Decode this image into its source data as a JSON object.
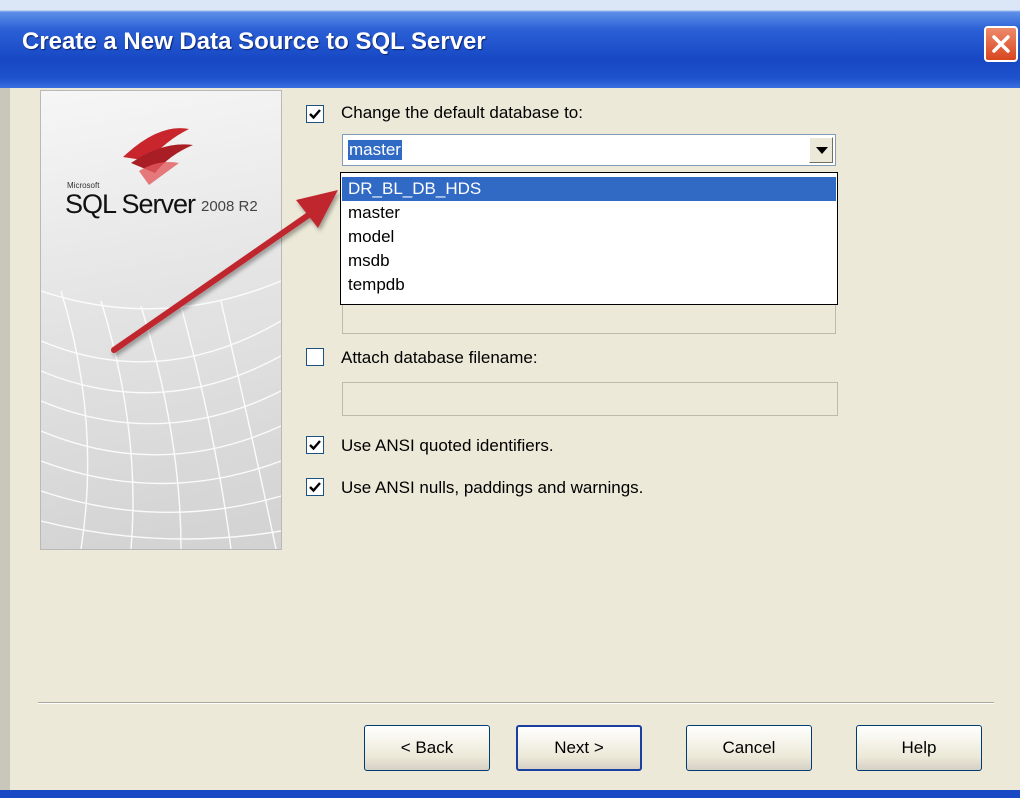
{
  "window": {
    "title": "Create a New Data Source to SQL Server",
    "close_icon": "close-icon"
  },
  "logo": {
    "brand": "Microsoft",
    "product": "SQL Server",
    "version": "2008 R2"
  },
  "options": {
    "change_default_db": {
      "label": "Change the default database to:",
      "checked": true
    },
    "default_db_value": "master",
    "dropdown_items": [
      "DR_BL_DB_HDS",
      "master",
      "model",
      "msdb",
      "tempdb"
    ],
    "highlighted_item": "DR_BL_DB_HDS",
    "attach_db": {
      "label": "Attach database filename:",
      "checked": false
    },
    "ansi_quoted": {
      "label": "Use ANSI quoted identifiers.",
      "checked": true
    },
    "ansi_nulls": {
      "label": "Use ANSI nulls, paddings and warnings.",
      "checked": true
    }
  },
  "buttons": {
    "back": "< Back",
    "next": "Next >",
    "cancel": "Cancel",
    "help": "Help"
  },
  "colors": {
    "titlebar": "#1848c4",
    "selection": "#316ac5",
    "annotation_arrow": "#c0282d",
    "dialog_bg": "#ece9d8"
  }
}
